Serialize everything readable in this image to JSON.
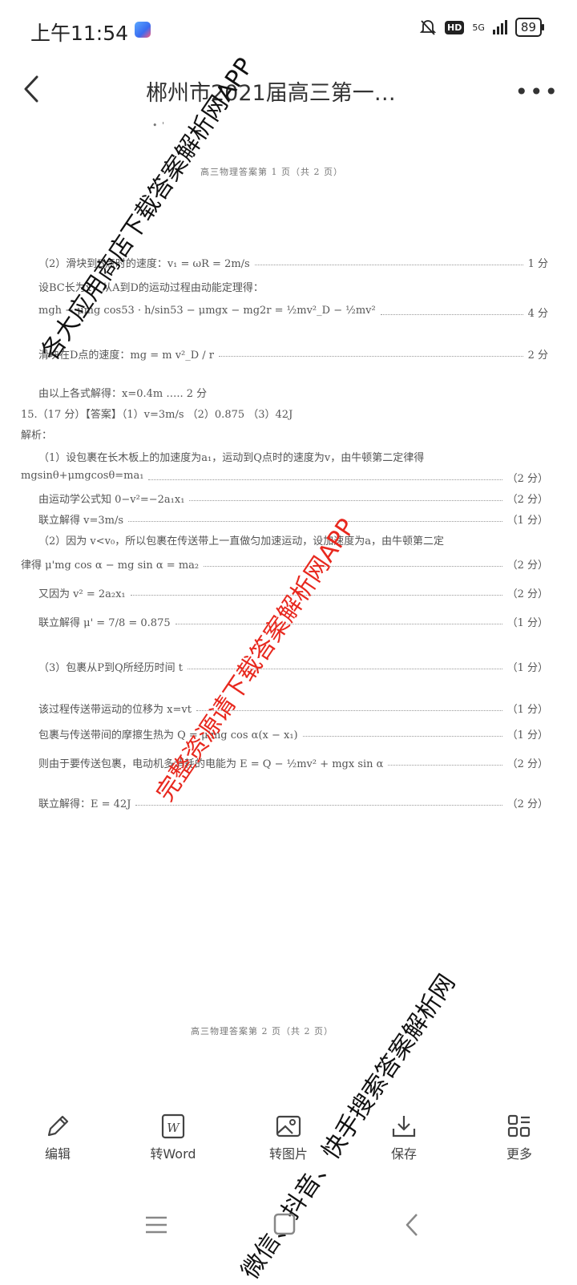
{
  "status_bar": {
    "time": "上午11:54",
    "network": "5G",
    "battery": "89"
  },
  "header": {
    "title": "郴州市2021届高三第一…"
  },
  "document": {
    "page1_footer": "高三物理答案第 1 页（共 2 页）",
    "lines": [
      {
        "text": "（2）滑块到B点时的速度：v₁ = ωR = 2m/s",
        "score": "1 分"
      },
      {
        "text": "设BC长为x，从A到D的运动过程由动能定理得：",
        "score": ""
      },
      {
        "text": "mgh − μmg cos53 · h/sin53 − μmgx − mg2r = ½mv²_D − ½mv²",
        "score": "4 分"
      },
      {
        "text": "滑块在D点的速度：mg = m v²_D / r",
        "score": "2 分"
      },
      {
        "text": "由以上各式解得：x=0.4m ….. 2 分",
        "score": ""
      },
      {
        "text": "15.（17 分）【答案】（1）v=3m/s    （2）0.875    （3）42J",
        "score": ""
      },
      {
        "text": "解析：",
        "score": ""
      },
      {
        "text": "（1）设包裹在长木板上的加速度为a₁，运动到Q点时的速度为v，由牛顿第二定律得",
        "score": ""
      },
      {
        "text": "mgsinθ+μmgcosθ=ma₁",
        "score": "（2 分）"
      },
      {
        "text": "由运动学公式知 0−v²=−2a₁x₁",
        "score": "（2 分）"
      },
      {
        "text": "联立解得 v=3m/s",
        "score": "（1 分）"
      },
      {
        "text": "（2）因为 v<v₀，所以包裹在传送带上一直做匀加速运动，设加速度为a，由牛顿第二定",
        "score": ""
      },
      {
        "text": "律得 μ'mg cos α − mg sin α = ma₂",
        "score": "（2 分）"
      },
      {
        "text": "又因为 v² = 2a₂x₁",
        "score": "（2 分）"
      },
      {
        "text": "联立解得 μ' = 7/8 = 0.875",
        "score": "（1 分）"
      },
      {
        "text": "（3）包裹从P到Q所经历时间 t",
        "score": "（1 分）"
      },
      {
        "text": "该过程传送带运动的位移为 x=vt",
        "score": "（1 分）"
      },
      {
        "text": "包裹与传送带间的摩擦生热为 Q = μ'mg cos α(x − x₁)",
        "score": "（1 分）"
      },
      {
        "text": "则由于要传送包裹，电动机多消耗的电能为 E = Q − ½mv² + mgx sin α",
        "score": "（2 分）"
      },
      {
        "text": "联立解得：E = 42J",
        "score": "（2 分）"
      }
    ],
    "page2_footer": "高三物理答案第 2 页（共 2 页）"
  },
  "watermarks": {
    "top": "各大应用商店下载答案解析网APP",
    "middle": "完整资源请下载答案解析网APP",
    "bottom": "微信、抖音、快手搜索答案解析网"
  },
  "toolbar": [
    {
      "label": "编辑",
      "icon": "pencil-icon"
    },
    {
      "label": "转Word",
      "icon": "word-icon"
    },
    {
      "label": "转图片",
      "icon": "image-icon"
    },
    {
      "label": "保存",
      "icon": "download-icon"
    },
    {
      "label": "更多",
      "icon": "grid-icon"
    }
  ]
}
